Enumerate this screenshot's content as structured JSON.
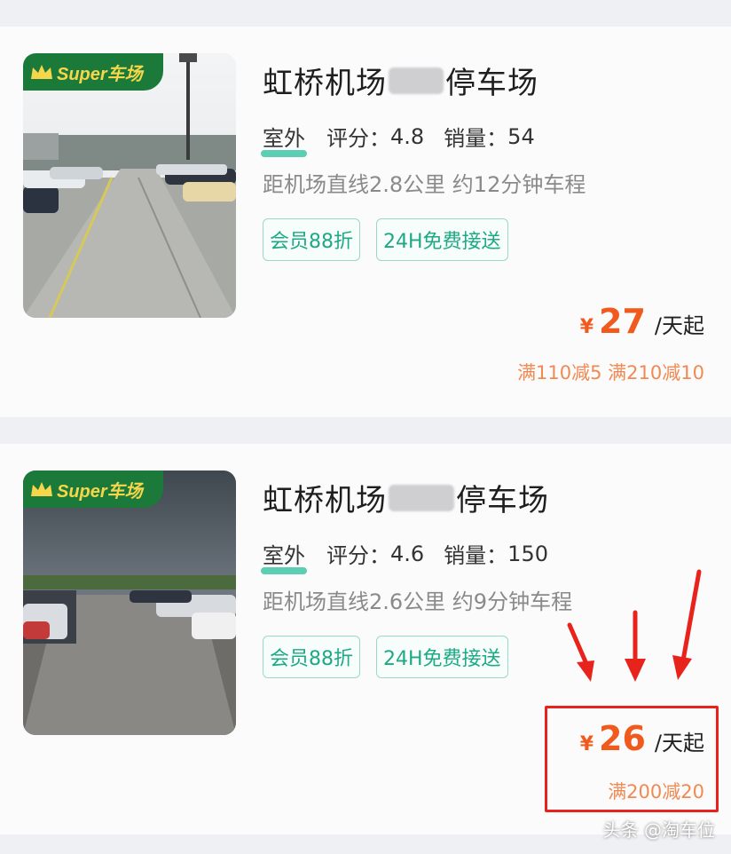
{
  "listings": [
    {
      "badge": "Super车场",
      "title_prefix": "虹桥机场",
      "title_suffix": "停车场",
      "type": "室外",
      "rating_label": "评分：",
      "rating": "4.8",
      "sales_label": "销量：",
      "sales": "54",
      "distance": "距机场直线2.8公里 约12分钟车程",
      "tags": [
        "会员88折",
        "24H免费接送"
      ],
      "currency": "¥",
      "price": "27",
      "price_unit": "/天起",
      "discount": "满110减5 满210减10"
    },
    {
      "badge": "Super车场",
      "title_prefix": "虹桥机场",
      "title_suffix": "停车场",
      "type": "室外",
      "rating_label": "评分：",
      "rating": "4.6",
      "sales_label": "销量：",
      "sales": "150",
      "distance": "距机场直线2.6公里 约9分钟车程",
      "tags": [
        "会员88折",
        "24H免费接送"
      ],
      "currency": "¥",
      "price": "26",
      "price_unit": "/天起",
      "discount": "满200减20"
    }
  ],
  "watermark": "头条 @淘车位",
  "colors": {
    "accent_price": "#f05a1d",
    "tag_green": "#1ea985",
    "badge_green": "#1b7a3a",
    "highlight_red": "#e8231c"
  }
}
